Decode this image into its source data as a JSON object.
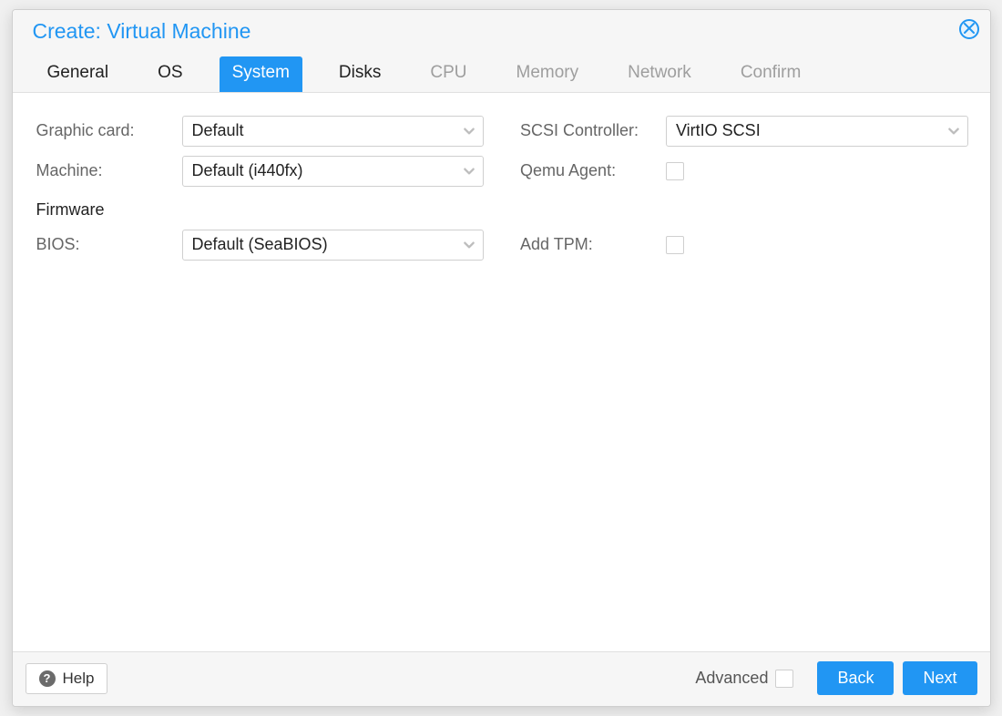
{
  "dialog": {
    "title": "Create: Virtual Machine"
  },
  "tabs": [
    {
      "label": "General",
      "state": "enabled"
    },
    {
      "label": "OS",
      "state": "enabled"
    },
    {
      "label": "System",
      "state": "active"
    },
    {
      "label": "Disks",
      "state": "enabled"
    },
    {
      "label": "CPU",
      "state": "disabled"
    },
    {
      "label": "Memory",
      "state": "disabled"
    },
    {
      "label": "Network",
      "state": "disabled"
    },
    {
      "label": "Confirm",
      "state": "disabled"
    }
  ],
  "form": {
    "graphic_card": {
      "label": "Graphic card:",
      "value": "Default"
    },
    "machine": {
      "label": "Machine:",
      "value": "Default (i440fx)"
    },
    "firmware_header": "Firmware",
    "bios": {
      "label": "BIOS:",
      "value": "Default (SeaBIOS)"
    },
    "scsi_controller": {
      "label": "SCSI Controller:",
      "value": "VirtIO SCSI"
    },
    "qemu_agent": {
      "label": "Qemu Agent:",
      "checked": false
    },
    "add_tpm": {
      "label": "Add TPM:",
      "checked": false
    }
  },
  "footer": {
    "help": "Help",
    "advanced": "Advanced",
    "back": "Back",
    "next": "Next"
  }
}
